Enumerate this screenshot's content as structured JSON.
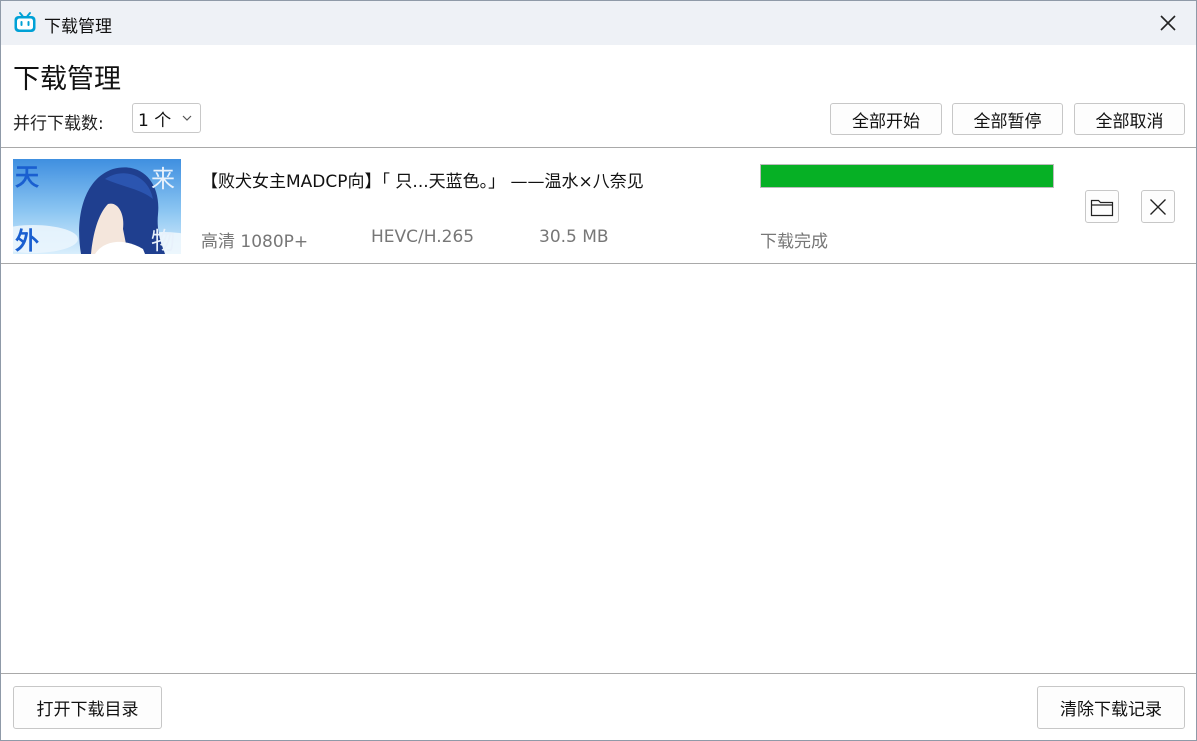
{
  "window": {
    "title": "下载管理",
    "app_icon": "bilibili-tv-icon",
    "accent_color": "#00a1d6"
  },
  "header": {
    "heading": "下载管理",
    "parallel_label": "并行下载数:",
    "parallel_value": "1 个",
    "buttons": {
      "start_all": "全部开始",
      "pause_all": "全部暂停",
      "cancel_all": "全部取消"
    }
  },
  "downloads": [
    {
      "title": "【败犬女主MADCP向】「 只...天蓝色。」 ——温水×八奈见",
      "thumbnail_chars": [
        "天",
        "外",
        "来",
        "物"
      ],
      "quality": "高清 1080P+",
      "codec": "HEVC/H.265",
      "size": "30.5 MB",
      "status": "下载完成",
      "progress_fraction": 1.0,
      "progress_color": "#06b025",
      "icons": [
        "folder-icon",
        "close-icon"
      ]
    }
  ],
  "footer": {
    "open_dir": "打开下载目录",
    "clear_records": "清除下载记录"
  }
}
